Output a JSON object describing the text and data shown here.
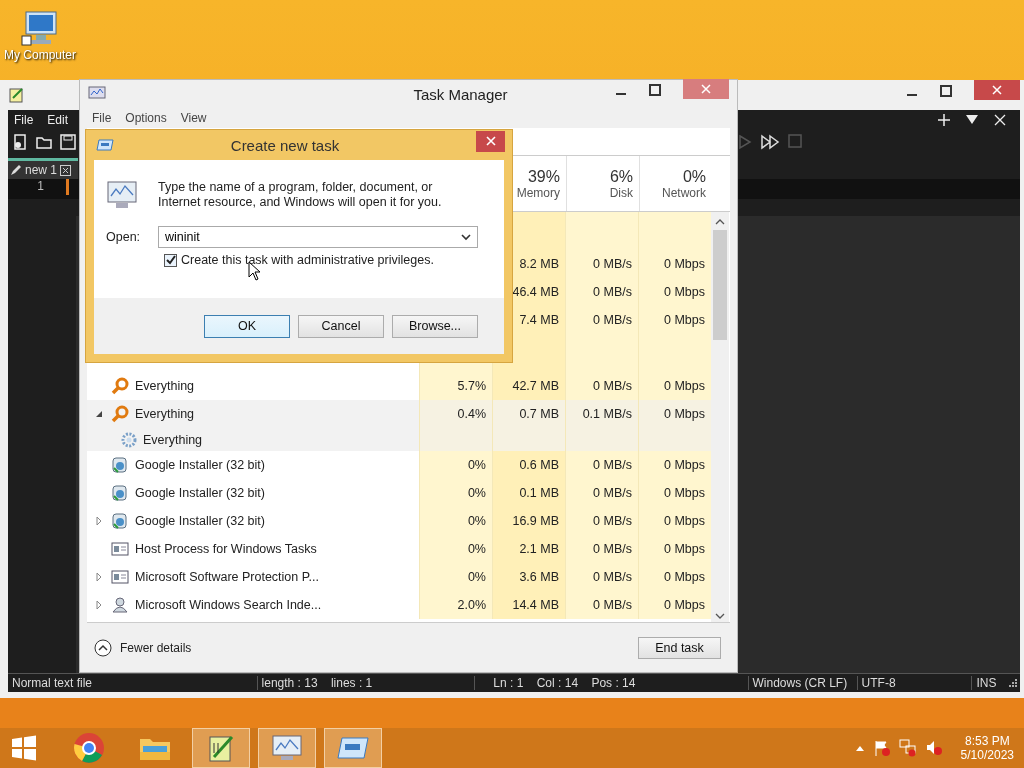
{
  "desktop": {
    "icons": [
      {
        "label": "My Computer"
      }
    ]
  },
  "editor": {
    "menu": [
      "File",
      "Edit"
    ],
    "tab": {
      "label": "new 1",
      "selected": true
    },
    "line_number": "1",
    "status_bar": [
      "Normal text file",
      "length : 13    lines : 1",
      "Ln : 1    Col : 14    Pos : 14",
      "Windows (CR LF)",
      "UTF-8",
      "INS"
    ]
  },
  "task_manager": {
    "title": "Task Manager",
    "menu": [
      "File",
      "Options",
      "View"
    ],
    "columns": [
      {
        "percent": "39%",
        "label": "Memory"
      },
      {
        "percent": "6%",
        "label": "Disk"
      },
      {
        "percent": "0%",
        "label": "Network"
      }
    ],
    "rows": [
      {
        "kind": "spacer",
        "selected": false
      },
      {
        "kind": "process",
        "selected": false,
        "memory": "8.2 MB",
        "disk": "0 MB/s",
        "network": "0 Mbps"
      },
      {
        "kind": "process",
        "selected": false,
        "memory": "46.4 MB",
        "disk": "0 MB/s",
        "network": "0 Mbps"
      },
      {
        "kind": "process",
        "selected": false,
        "memory": "7.4 MB",
        "disk": "0 MB/s",
        "network": "0 Mbps"
      },
      {
        "kind": "spacer",
        "selected": false
      },
      {
        "kind": "everything",
        "name": "Everything",
        "selected": false,
        "cpu": "5.7%",
        "memory": "42.7 MB",
        "disk": "0 MB/s",
        "network": "0 Mbps"
      },
      {
        "kind": "everything",
        "name": "Everything",
        "expanded": true,
        "selected": true,
        "cpu": "0.4%",
        "memory": "0.7 MB",
        "disk": "0.1 MB/s",
        "network": "0 Mbps"
      },
      {
        "kind": "service",
        "name": "Everything",
        "selected": true
      },
      {
        "kind": "installer",
        "name": "Google Installer (32 bit)",
        "selected": false,
        "cpu": "0%",
        "memory": "0.6 MB",
        "disk": "0 MB/s",
        "network": "0 Mbps"
      },
      {
        "kind": "installer",
        "name": "Google Installer (32 bit)",
        "selected": false,
        "cpu": "0%",
        "memory": "0.1 MB",
        "disk": "0 MB/s",
        "network": "0 Mbps"
      },
      {
        "kind": "installer",
        "name": "Google Installer (32 bit)",
        "expanded": false,
        "selected": false,
        "cpu": "0%",
        "memory": "16.9 MB",
        "disk": "0 MB/s",
        "network": "0 Mbps"
      },
      {
        "kind": "host",
        "name": "Host Process for Windows Tasks",
        "selected": false,
        "cpu": "0%",
        "memory": "2.1 MB",
        "disk": "0 MB/s",
        "network": "0 Mbps"
      },
      {
        "kind": "host",
        "name": "Microsoft Software Protection P...",
        "expanded": false,
        "selected": false,
        "cpu": "0%",
        "memory": "3.6 MB",
        "disk": "0 MB/s",
        "network": "0 Mbps"
      },
      {
        "kind": "search",
        "name": "Microsoft Windows Search Inde...",
        "expanded": false,
        "selected": false,
        "cpu": "2.0%",
        "memory": "14.4 MB",
        "disk": "0 MB/s",
        "network": "0 Mbps"
      }
    ],
    "fewer_details": "Fewer details",
    "end_task": "End task"
  },
  "dialog": {
    "title": "Create new task",
    "message": "Type the name of a program, folder, document, or Internet resource, and Windows will open it for you.",
    "open_label": "Open:",
    "open_value": "wininit",
    "admin_checkbox": {
      "label": "Create this task with administrative privileges.",
      "checked": true
    },
    "buttons": [
      {
        "label": "OK",
        "default": true
      },
      {
        "label": "Cancel",
        "default": false
      },
      {
        "label": "Browse...",
        "default": false
      }
    ]
  },
  "taskbar": {
    "apps": [
      {
        "kind": "chrome",
        "active": false
      },
      {
        "kind": "explorer",
        "active": false
      },
      {
        "kind": "notepad",
        "active": true
      },
      {
        "kind": "taskmgr",
        "active": true
      },
      {
        "kind": "run",
        "active": true
      }
    ],
    "time": "8:53 PM",
    "date": "5/10/2023"
  }
}
